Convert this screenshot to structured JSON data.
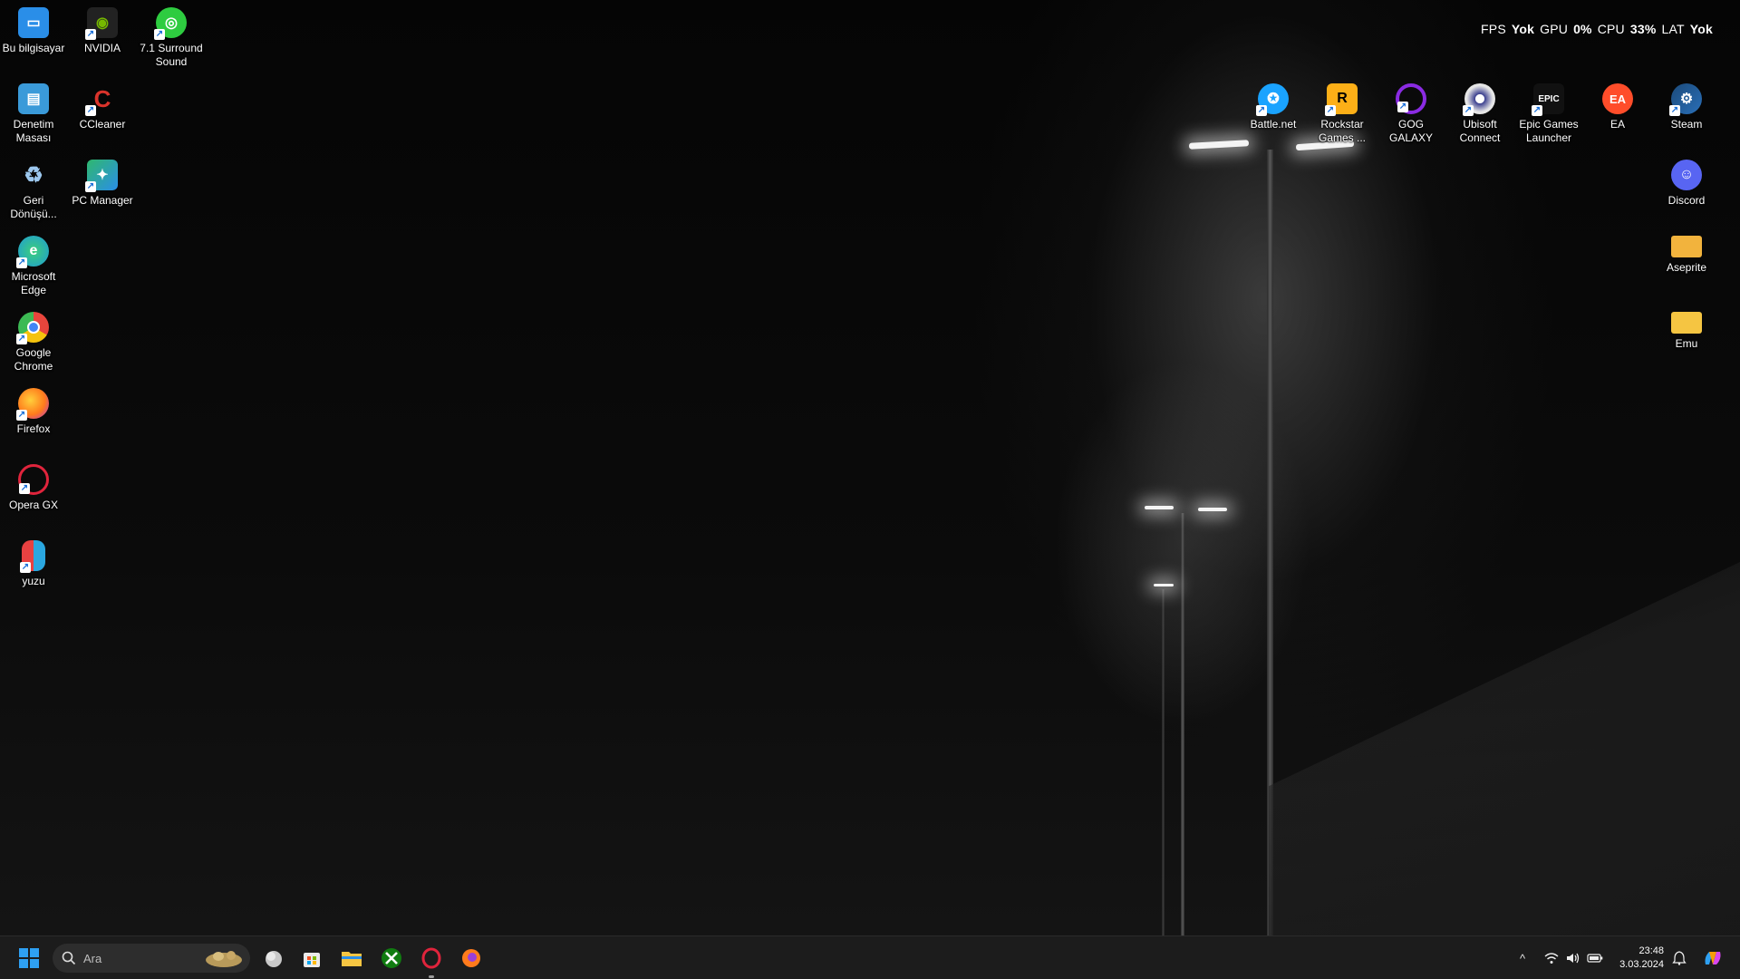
{
  "overlay": {
    "fps_label": "FPS",
    "fps_value": "Yok",
    "gpu_label": "GPU",
    "gpu_value": "0%",
    "cpu_label": "CPU",
    "cpu_value": "33%",
    "lat_label": "LAT",
    "lat_value": "Yok"
  },
  "desktop_left": [
    {
      "label": "Bu bilgisayar",
      "icon": "this-pc-icon",
      "color": "#2a8ee8"
    },
    {
      "label": "NVIDIA",
      "icon": "nvidia-icon",
      "color": "#76b900"
    },
    {
      "label": "7.1 Surround Sound",
      "icon": "surround-sound-icon",
      "color": "#2ecc40"
    },
    {
      "label": "Denetim Masası",
      "icon": "control-panel-icon",
      "color": "#3a9ad9"
    },
    {
      "label": "CCleaner",
      "icon": "ccleaner-icon",
      "color": "#d9332b"
    },
    {
      "label": "Geri Dönüşü...",
      "icon": "recycle-bin-icon",
      "color": "#6ea6d8"
    },
    {
      "label": "PC Manager",
      "icon": "pc-manager-icon",
      "color": "#2fb86e"
    },
    {
      "label": "Microsoft Edge",
      "icon": "edge-icon",
      "color": "#1e9bd7"
    },
    {
      "label": "Google Chrome",
      "icon": "chrome-icon",
      "color": "#e8453c"
    },
    {
      "label": "Firefox",
      "icon": "firefox-icon",
      "color": "#ff7b1c"
    },
    {
      "label": "Opera GX",
      "icon": "opera-gx-icon",
      "color": "#e0243c"
    },
    {
      "label": "yuzu",
      "icon": "yuzu-icon",
      "color": "#e84141"
    }
  ],
  "desktop_right": [
    {
      "label": "Battle.net",
      "icon": "battlenet-icon",
      "color": "#1aa3ff"
    },
    {
      "label": "Rockstar Games ...",
      "icon": "rockstar-icon",
      "color": "#fcaf17"
    },
    {
      "label": "GOG GALAXY",
      "icon": "gog-galaxy-icon",
      "color": "#8a2be2"
    },
    {
      "label": "Ubisoft Connect",
      "icon": "ubisoft-icon",
      "color": "#3b3f8f"
    },
    {
      "label": "Epic Games Launcher",
      "icon": "epic-games-icon",
      "color": "#2a2a2a"
    },
    {
      "label": "EA",
      "icon": "ea-icon",
      "color": "#ff4d2a"
    },
    {
      "label": "Steam",
      "icon": "steam-icon",
      "color": "#1b4a7a"
    },
    {
      "label": "Discord",
      "icon": "discord-icon",
      "color": "#5865f2"
    },
    {
      "label": "Aseprite",
      "icon": "aseprite-folder-icon",
      "color": "#f2b33d"
    },
    {
      "label": "Emu",
      "icon": "emu-folder-icon",
      "color": "#f5c542"
    }
  ],
  "taskbar": {
    "search_placeholder": "Ara",
    "apps": [
      {
        "name": "start-icon"
      },
      {
        "name": "weather-widget-icon"
      },
      {
        "name": "microsoft-store-icon"
      },
      {
        "name": "file-explorer-icon"
      },
      {
        "name": "xbox-icon"
      },
      {
        "name": "opera-gx-icon"
      },
      {
        "name": "firefox-icon"
      }
    ],
    "tray": {
      "chevron": "^"
    },
    "clock_time": "23:48",
    "clock_date": "3.03.2024"
  }
}
